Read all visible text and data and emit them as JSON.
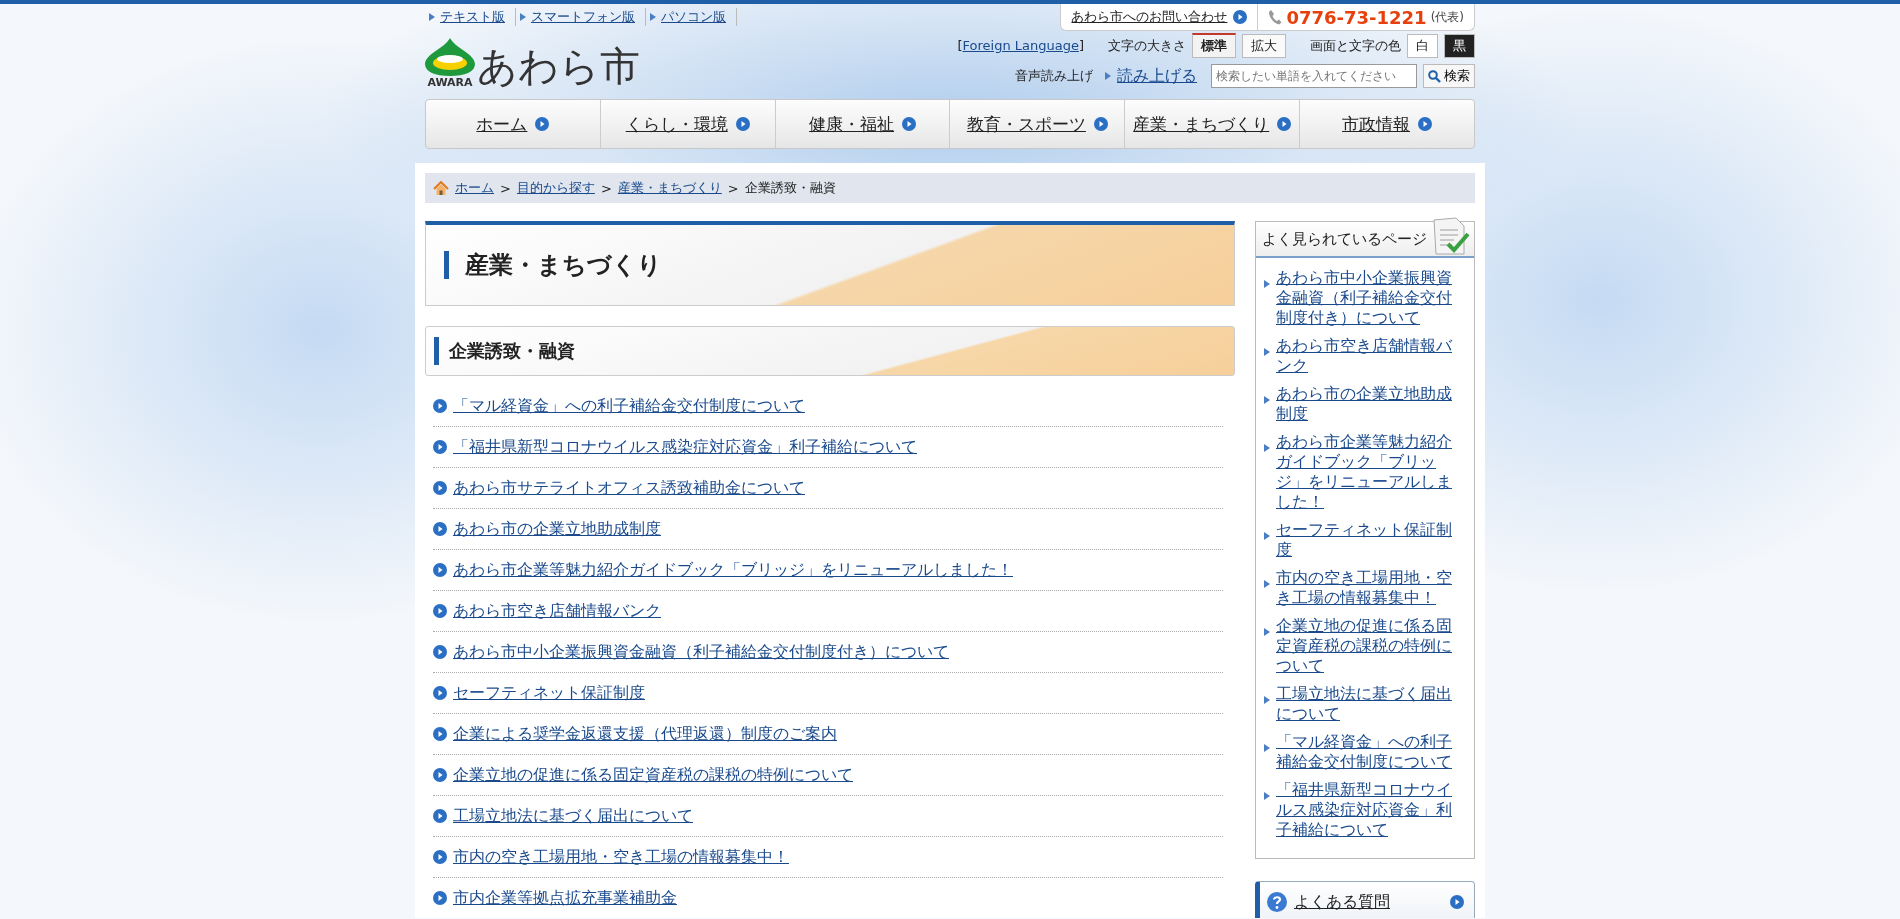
{
  "top_links": [
    "テキスト版",
    "スマートフォン版",
    "パソコン版"
  ],
  "contact": {
    "label": "あわら市へのお問い合わせ",
    "phone": "0776-73-1221",
    "phone_note": "(代表)"
  },
  "logo": {
    "name": "あわら市",
    "romaji": "AWARA"
  },
  "foreign_language": {
    "open": "[",
    "label": "Foreign Language",
    "close": "]"
  },
  "font_size": {
    "label": "文字の大きさ",
    "options": [
      {
        "label": "標準",
        "selected": true
      },
      {
        "label": "拡大",
        "selected": false
      }
    ]
  },
  "color_scheme": {
    "label": "画面と文字の色",
    "options": [
      {
        "label": "白",
        "color": "#ffffff"
      },
      {
        "label": "黒",
        "color": "#222222"
      }
    ]
  },
  "read_aloud": {
    "label": "音声読み上げ",
    "link": "読み上げる"
  },
  "search": {
    "placeholder": "検索したい単語を入れてください",
    "button": "検索"
  },
  "nav": [
    "ホーム",
    "くらし・環境",
    "健康・福祉",
    "教育・スポーツ",
    "産業・まちづくり",
    "市政情報"
  ],
  "breadcrumb": {
    "separator": ">",
    "items": [
      {
        "label": "ホーム",
        "link": true
      },
      {
        "label": "目的から探す",
        "link": true
      },
      {
        "label": "産業・まちづくり",
        "link": true
      },
      {
        "label": "企業誘致・融資",
        "link": false
      }
    ]
  },
  "page_title": "産業・まちづくり",
  "section_title": "企業誘致・融資",
  "articles": [
    "「マル経資金」への利子補給金交付制度について",
    "「福井県新型コロナウイルス感染症対応資金」利子補給について",
    "あわら市サテライトオフィス誘致補助金について",
    "あわら市の企業立地助成制度",
    "あわら市企業等魅力紹介ガイドブック「ブリッジ」をリニューアルしました！",
    "あわら市空き店舗情報バンク",
    "あわら市中小企業振興資金融資（利子補給金交付制度付き）について",
    "セーフティネット保証制度",
    "企業による奨学金返還支援（代理返還）制度のご案内",
    "企業立地の促進に係る固定資産税の課税の特例について",
    "工場立地法に基づく届出について",
    "市内の空き工場用地・空き工場の情報募集中！",
    "市内企業等拠点拡充事業補助金"
  ],
  "sidebar": {
    "title": "よく見られているページ",
    "items": [
      "あわら市中小企業振興資金融資（利子補給金交付制度付き）について",
      "あわら市空き店舗情報バンク",
      "あわら市の企業立地助成制度",
      "あわら市企業等魅力紹介ガイドブック「ブリッジ」をリニューアルしました！",
      "セーフティネット保証制度",
      "市内の空き工場用地・空き工場の情報募集中！",
      "企業立地の促進に係る固定資産税の課税の特例について",
      "工場立地法に基づく届出について",
      "「マル経資金」への利子補給金交付制度について",
      "「福井県新型コロナウイルス感染症対応資金」利子補給について"
    ]
  },
  "faq": {
    "label": "よくある質問"
  }
}
